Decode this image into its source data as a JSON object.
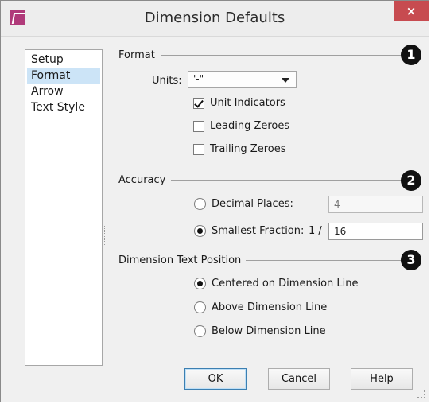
{
  "window": {
    "title": "Dimension Defaults",
    "close_glyph": "×",
    "icon": "app-icon"
  },
  "nav": {
    "items": [
      "Setup",
      "Format",
      "Arrow",
      "Text Style"
    ],
    "selected": "Format"
  },
  "format": {
    "section_label": "Format",
    "badge": "1",
    "units_label": "Units:",
    "units_value": "'-\"",
    "unit_indicators": {
      "label": "Unit Indicators",
      "checked": true
    },
    "leading_zeroes": {
      "label": "Leading Zeroes",
      "checked": false
    },
    "trailing_zeroes": {
      "label": "Trailing Zeroes",
      "checked": false
    }
  },
  "accuracy": {
    "section_label": "Accuracy",
    "badge": "2",
    "decimal_places": {
      "label": "Decimal Places:",
      "value": "4",
      "selected": false
    },
    "smallest_fraction": {
      "label": "Smallest Fraction:",
      "prefix": "1 /",
      "value": "16",
      "selected": true
    }
  },
  "text_position": {
    "section_label": "Dimension Text Position",
    "badge": "3",
    "options": [
      {
        "label": "Centered on Dimension Line",
        "selected": true
      },
      {
        "label": "Above Dimension Line",
        "selected": false
      },
      {
        "label": "Below Dimension Line",
        "selected": false
      }
    ]
  },
  "buttons": {
    "ok": "OK",
    "cancel": "Cancel",
    "help": "Help"
  },
  "colors": {
    "close_red": "#c74b50",
    "selection_blue": "#cce4f7",
    "app_icon": "#b03a7a"
  }
}
